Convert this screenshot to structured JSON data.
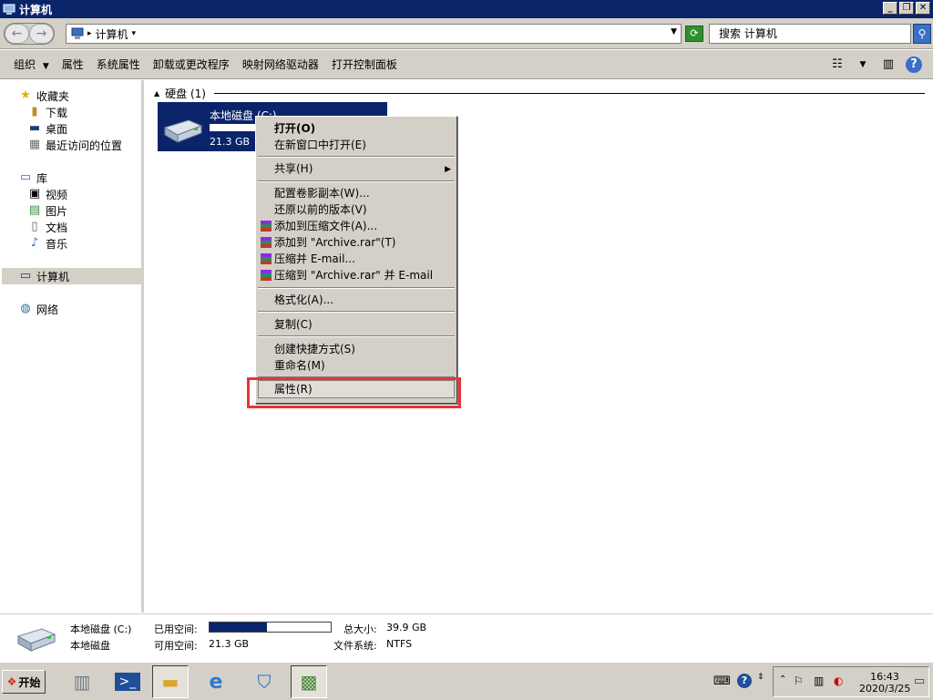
{
  "window": {
    "title": "计算机"
  },
  "address": {
    "segment": "计算机",
    "search_placeholder": "搜索 计算机"
  },
  "toolbar": {
    "items": [
      "组织",
      "属性",
      "系统属性",
      "卸载或更改程序",
      "映射网络驱动器",
      "打开控制面板"
    ]
  },
  "sidebar": {
    "favorites": "收藏夹",
    "downloads": "下载",
    "desktop": "桌面",
    "recent": "最近访问的位置",
    "libraries": "库",
    "videos": "视频",
    "pictures": "图片",
    "documents": "文档",
    "music": "音乐",
    "computer": "计算机",
    "network": "网络"
  },
  "main": {
    "group_label": "硬盘 (1)",
    "drive": {
      "name": "本地磁盘 (C:)",
      "free_text": "21.3 GB",
      "used_fraction": 0.47
    }
  },
  "context_menu": {
    "open": "打开(O)",
    "open_new": "在新窗口中打开(E)",
    "share": "共享(H)",
    "shadow_copy": "配置卷影副本(W)...",
    "restore": "还原以前的版本(V)",
    "add_archive": "添加到压缩文件(A)...",
    "add_rar": "添加到 \"Archive.rar\"(T)",
    "compress_email": "压缩并 E-mail...",
    "compress_rar_email": "压缩到 \"Archive.rar\" 并 E-mail",
    "format": "格式化(A)...",
    "copy": "复制(C)",
    "shortcut": "创建快捷方式(S)",
    "rename": "重命名(M)",
    "properties": "属性(R)"
  },
  "details": {
    "name": "本地磁盘 (C:)",
    "type": "本地磁盘",
    "used_label": "已用空间:",
    "free_label": "可用空间:",
    "free_value": "21.3 GB",
    "total_label": "总大小:",
    "total_value": "39.9 GB",
    "fs_label": "文件系统:",
    "fs_value": "NTFS",
    "used_fraction": 0.47
  },
  "taskbar": {
    "start": "开始",
    "time": "16:43",
    "date": "2020/3/25"
  },
  "colors": {
    "selection": "#0a246a",
    "highlight_box": "#e8333a",
    "menu_bg": "#d4d0c8"
  }
}
